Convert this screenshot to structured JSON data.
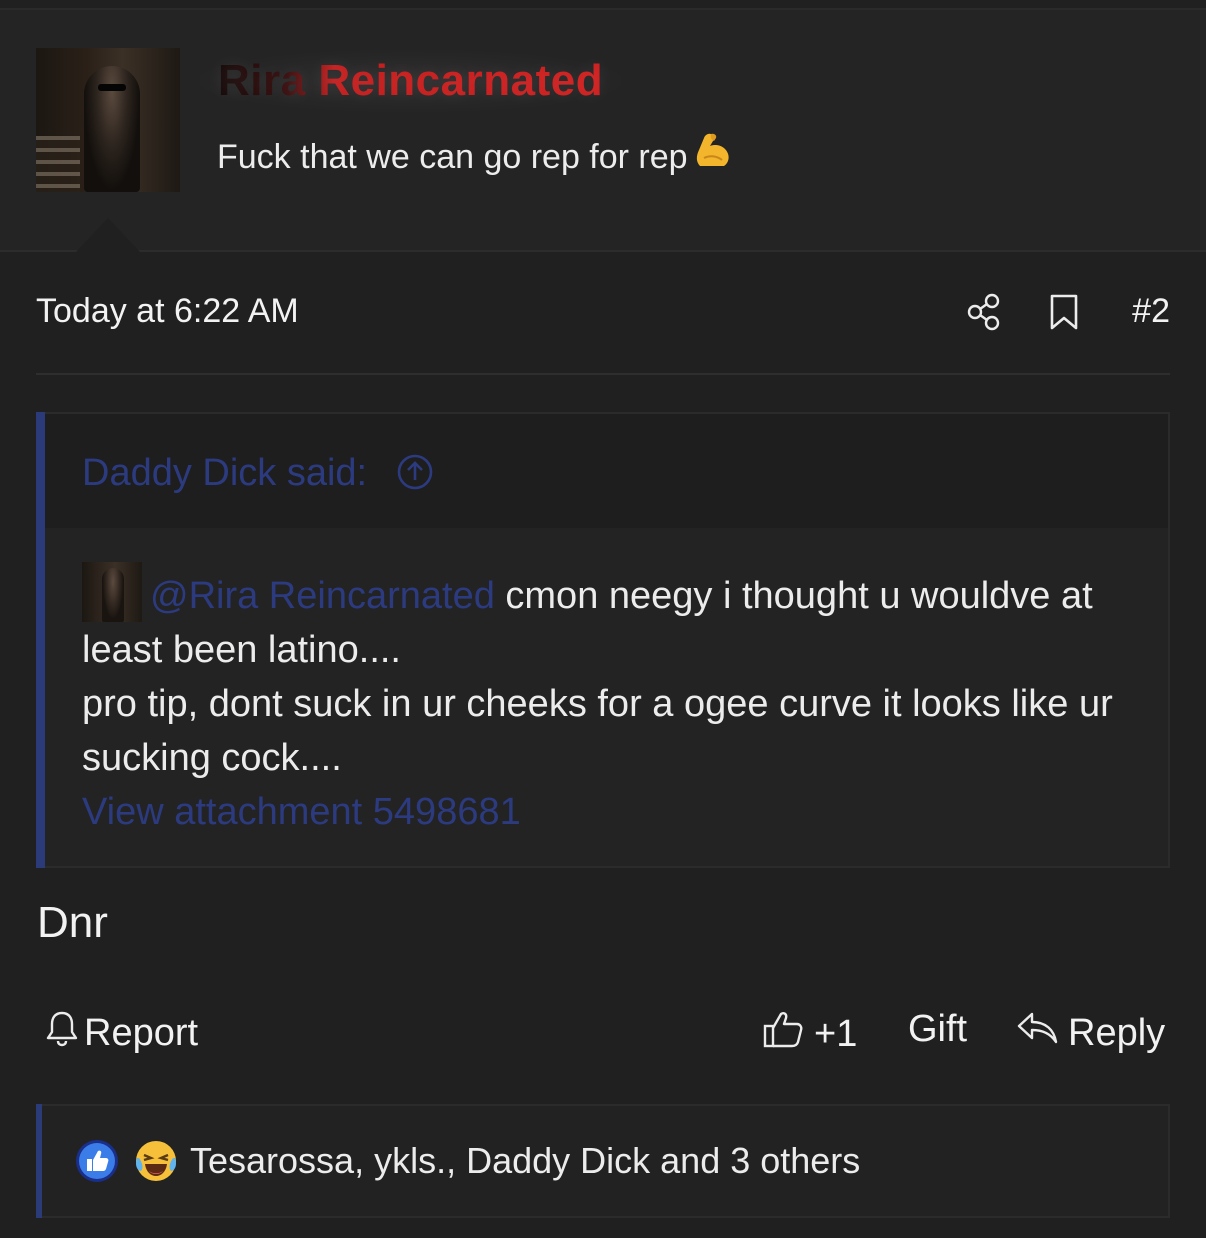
{
  "author": {
    "username": "Rira Reincarnated",
    "signature": "Fuck that we can go rep for rep",
    "signature_emoji": "flexed-biceps"
  },
  "post": {
    "timestamp": "Today at 6:22 AM",
    "number": "#2",
    "body": "Dnr"
  },
  "quote": {
    "author": "Daddy Dick said:",
    "mention": "@Rira Reincarnated",
    "text_line1": " cmon neegy i thought u wouldve at least been latino....",
    "text_line2": "pro tip, dont suck in ur cheeks for a ogee curve it looks like ur sucking cock....",
    "attachment": "View attachment 5498681"
  },
  "actions": {
    "report": "Report",
    "like_count": "+1",
    "gift": "Gift",
    "reply": "Reply"
  },
  "reactions": {
    "text": "Tesarossa, ykls., Daddy Dick and 3 others",
    "icons": [
      "like-icon",
      "laughing-crying-icon"
    ]
  },
  "colors": {
    "background": "#202021",
    "link": "#2c3b80",
    "username_red": "#cf2020",
    "quote_bar": "#2b3a78"
  }
}
